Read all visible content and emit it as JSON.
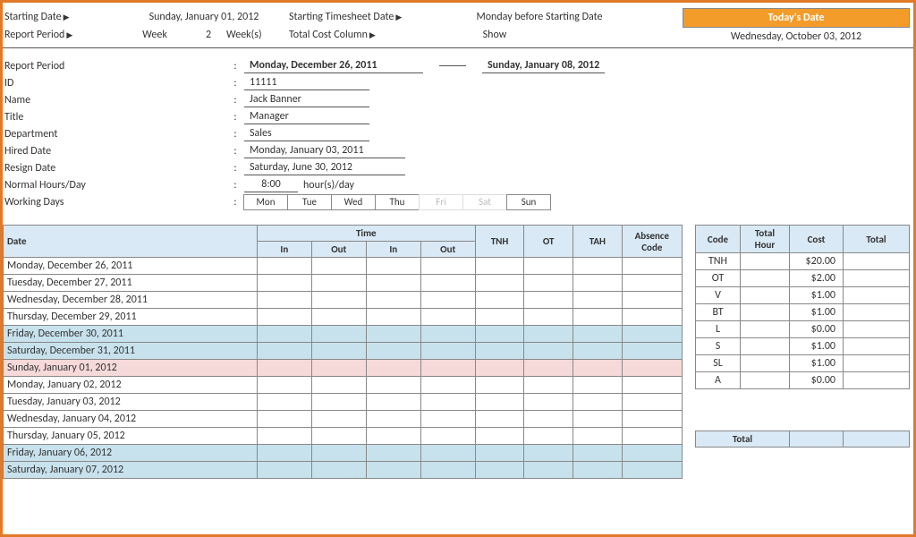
{
  "config": {
    "starting_date_label": "Starting Date",
    "starting_date_value": "Sunday, January 01, 2012",
    "starting_ts_label": "Starting Timesheet Date",
    "starting_ts_value": "Monday before Starting Date",
    "report_period_label": "Report Period",
    "report_period_value": "Week",
    "report_period_num": "2",
    "report_period_unit": "Week(s)",
    "total_cost_label": "Total Cost Column",
    "total_cost_value": "Show",
    "todays_date_label": "Today's Date",
    "todays_date_value": "Wednesday, October 03, 2012"
  },
  "info": {
    "report_period_label": "Report Period",
    "report_period_from": "Monday, December 26, 2011",
    "report_period_to": "Sunday, January 08, 2012",
    "id_label": "ID",
    "id_value": "11111",
    "name_label": "Name",
    "name_value": "Jack Banner",
    "title_label": "Title",
    "title_value": "Manager",
    "dept_label": "Department",
    "dept_value": "Sales",
    "hired_label": "Hired Date",
    "hired_value": "Monday, January 03, 2011",
    "resign_label": "Resign Date",
    "resign_value": "Saturday, June 30, 2012",
    "hours_label": "Normal Hours/Day",
    "hours_value": "8:00",
    "hours_unit": "hour(s)/day",
    "working_days_label": "Working Days",
    "days": [
      "Mon",
      "Tue",
      "Wed",
      "Thu",
      "Fri",
      "Sat",
      "Sun"
    ],
    "days_off": [
      4,
      5
    ]
  },
  "headers": {
    "date": "Date",
    "time": "Time",
    "in": "In",
    "out": "Out",
    "tnh": "TNH",
    "ot": "OT",
    "tah": "TAH",
    "absence": "Absence Code",
    "code": "Code",
    "total_hour": "Total Hour",
    "cost": "Cost",
    "total": "Total"
  },
  "dates": [
    {
      "label": "Monday, December 26, 2011",
      "cls": ""
    },
    {
      "label": "Tuesday, December 27, 2011",
      "cls": ""
    },
    {
      "label": "Wednesday, December 28, 2011",
      "cls": ""
    },
    {
      "label": "Thursday, December 29, 2011",
      "cls": ""
    },
    {
      "label": "Friday, December 30, 2011",
      "cls": "r-blue"
    },
    {
      "label": "Saturday, December 31, 2011",
      "cls": "r-blue"
    },
    {
      "label": "Sunday, January 01, 2012",
      "cls": "r-pink"
    },
    {
      "label": "Monday, January 02, 2012",
      "cls": ""
    },
    {
      "label": "Tuesday, January 03, 2012",
      "cls": ""
    },
    {
      "label": "Wednesday, January 04, 2012",
      "cls": ""
    },
    {
      "label": "Thursday, January 05, 2012",
      "cls": ""
    },
    {
      "label": "Friday, January 06, 2012",
      "cls": "r-blue"
    },
    {
      "label": "Saturday, January 07, 2012",
      "cls": "r-blue"
    }
  ],
  "cost_rows": [
    {
      "code": "TNH",
      "cost": "$20.00"
    },
    {
      "code": "OT",
      "cost": "$2.00"
    },
    {
      "code": "V",
      "cost": "$1.00"
    },
    {
      "code": "BT",
      "cost": "$1.00"
    },
    {
      "code": "L",
      "cost": "$0.00"
    },
    {
      "code": "S",
      "cost": "$1.00"
    },
    {
      "code": "SL",
      "cost": "$1.00"
    },
    {
      "code": "A",
      "cost": "$0.00"
    }
  ],
  "total_label": "Total"
}
